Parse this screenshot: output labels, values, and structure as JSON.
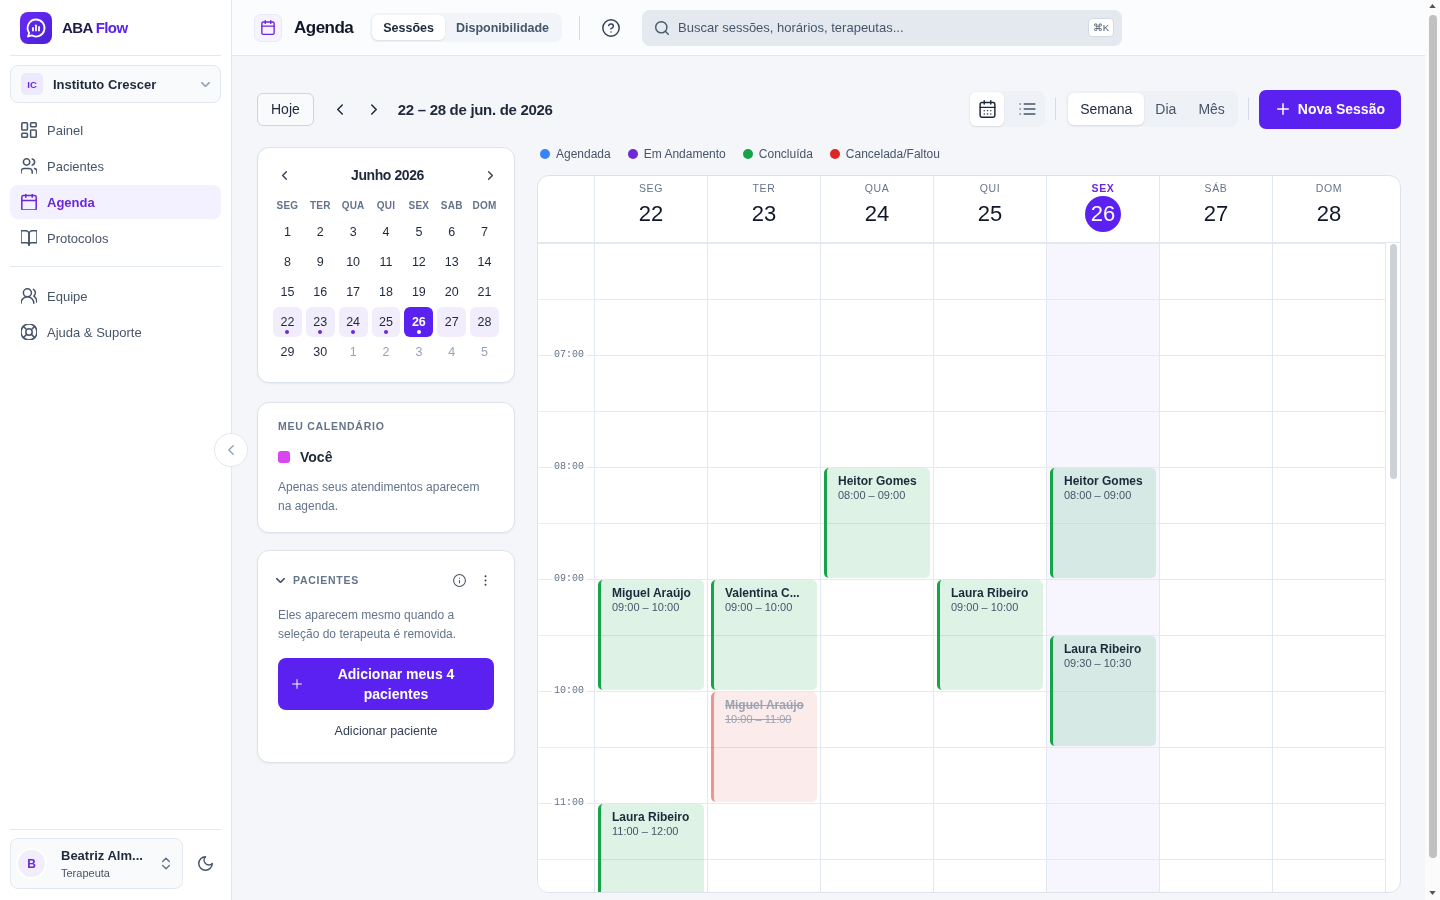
{
  "sidebar": {
    "brand": {
      "name": "ABA",
      "accent": "Flow"
    },
    "organization": {
      "initials": "IC",
      "name": "Instituto Crescer"
    },
    "nav": [
      {
        "label": "Painel",
        "selected": false
      },
      {
        "label": "Pacientes",
        "selected": false
      },
      {
        "label": "Agenda",
        "selected": true
      },
      {
        "label": "Protocolos",
        "selected": false
      }
    ],
    "nav_secondary": [
      {
        "label": "Equipe",
        "selected": false
      },
      {
        "label": "Ajuda & Suporte",
        "selected": false
      }
    ],
    "user": {
      "initial": "B",
      "name": "Beatriz Alm...",
      "role": "Terapeuta"
    }
  },
  "header": {
    "title": "Agenda",
    "tabs": [
      {
        "label": "Sessões",
        "selected": true
      },
      {
        "label": "Disponibilidade",
        "selected": false
      }
    ],
    "search": {
      "placeholder": "Buscar sessões, horários, terapeutas...",
      "shortcut": "⌘K"
    }
  },
  "toolbar": {
    "today_button": "Hoje",
    "range": "22 – 28 de jun. de 2026",
    "layouts": [
      {
        "selected": true
      },
      {
        "selected": false
      }
    ],
    "views": [
      {
        "label": "Semana",
        "selected": true
      },
      {
        "label": "Dia",
        "selected": false
      },
      {
        "label": "Mês",
        "selected": false
      }
    ],
    "new_button": "Nova Sessão"
  },
  "mini_calendar": {
    "title": "Junho 2026",
    "weekdays": [
      "SEG",
      "TER",
      "QUA",
      "QUI",
      "SEX",
      "SAB",
      "DOM"
    ],
    "weeks": [
      [
        {
          "day": "1",
          "other_month": false,
          "in_week": false,
          "selected": false,
          "has_sessions": false
        },
        {
          "day": "2",
          "other_month": false,
          "in_week": false,
          "selected": false,
          "has_sessions": false
        },
        {
          "day": "3",
          "other_month": false,
          "in_week": false,
          "selected": false,
          "has_sessions": false
        },
        {
          "day": "4",
          "other_month": false,
          "in_week": false,
          "selected": false,
          "has_sessions": false
        },
        {
          "day": "5",
          "other_month": false,
          "in_week": false,
          "selected": false,
          "has_sessions": false
        },
        {
          "day": "6",
          "other_month": false,
          "in_week": false,
          "selected": false,
          "has_sessions": false
        },
        {
          "day": "7",
          "other_month": false,
          "in_week": false,
          "selected": false,
          "has_sessions": false
        }
      ],
      [
        {
          "day": "8",
          "other_month": false,
          "in_week": false,
          "selected": false,
          "has_sessions": false
        },
        {
          "day": "9",
          "other_month": false,
          "in_week": false,
          "selected": false,
          "has_sessions": false
        },
        {
          "day": "10",
          "other_month": false,
          "in_week": false,
          "selected": false,
          "has_sessions": false
        },
        {
          "day": "11",
          "other_month": false,
          "in_week": false,
          "selected": false,
          "has_sessions": false
        },
        {
          "day": "12",
          "other_month": false,
          "in_week": false,
          "selected": false,
          "has_sessions": false
        },
        {
          "day": "13",
          "other_month": false,
          "in_week": false,
          "selected": false,
          "has_sessions": false
        },
        {
          "day": "14",
          "other_month": false,
          "in_week": false,
          "selected": false,
          "has_sessions": false
        }
      ],
      [
        {
          "day": "15",
          "other_month": false,
          "in_week": false,
          "selected": false,
          "has_sessions": false
        },
        {
          "day": "16",
          "other_month": false,
          "in_week": false,
          "selected": false,
          "has_sessions": false
        },
        {
          "day": "17",
          "other_month": false,
          "in_week": false,
          "selected": false,
          "has_sessions": false
        },
        {
          "day": "18",
          "other_month": false,
          "in_week": false,
          "selected": false,
          "has_sessions": false
        },
        {
          "day": "19",
          "other_month": false,
          "in_week": false,
          "selected": false,
          "has_sessions": false
        },
        {
          "day": "20",
          "other_month": false,
          "in_week": false,
          "selected": false,
          "has_sessions": false
        },
        {
          "day": "21",
          "other_month": false,
          "in_week": false,
          "selected": false,
          "has_sessions": false
        }
      ],
      [
        {
          "day": "22",
          "other_month": false,
          "in_week": true,
          "selected": false,
          "has_sessions": true
        },
        {
          "day": "23",
          "other_month": false,
          "in_week": true,
          "selected": false,
          "has_sessions": true
        },
        {
          "day": "24",
          "other_month": false,
          "in_week": true,
          "selected": false,
          "has_sessions": true
        },
        {
          "day": "25",
          "other_month": false,
          "in_week": true,
          "selected": false,
          "has_sessions": true
        },
        {
          "day": "26",
          "other_month": false,
          "in_week": true,
          "selected": true,
          "has_sessions": true
        },
        {
          "day": "27",
          "other_month": false,
          "in_week": true,
          "selected": false,
          "has_sessions": false
        },
        {
          "day": "28",
          "other_month": false,
          "in_week": true,
          "selected": false,
          "has_sessions": false
        }
      ],
      [
        {
          "day": "29",
          "other_month": false,
          "in_week": false,
          "selected": false,
          "has_sessions": false
        },
        {
          "day": "30",
          "other_month": false,
          "in_week": false,
          "selected": false,
          "has_sessions": false
        },
        {
          "day": "1",
          "other_month": true,
          "in_week": false,
          "selected": false,
          "has_sessions": false
        },
        {
          "day": "2",
          "other_month": true,
          "in_week": false,
          "selected": false,
          "has_sessions": false
        },
        {
          "day": "3",
          "other_month": true,
          "in_week": false,
          "selected": false,
          "has_sessions": false
        },
        {
          "day": "4",
          "other_month": true,
          "in_week": false,
          "selected": false,
          "has_sessions": false
        },
        {
          "day": "5",
          "other_month": true,
          "in_week": false,
          "selected": false,
          "has_sessions": false
        }
      ]
    ]
  },
  "my_calendar": {
    "heading": "MEU CALENDÁRIO",
    "calendars": [
      {
        "label": "Você",
        "color": "#d946ef"
      }
    ],
    "note": "Apenas seus atendimentos aparecem na agenda."
  },
  "patients_panel": {
    "heading": "PACIENTES",
    "expanded": true,
    "note": "Eles aparecem mesmo quando a seleção do terapeuta é removida.",
    "add_all_button": "Adicionar meus 4 pacientes",
    "add_link": "Adicionar paciente"
  },
  "legend": [
    {
      "kind": "scheduled",
      "label": "Agendada",
      "color": "#3b82f6"
    },
    {
      "kind": "in_progress",
      "label": "Em Andamento",
      "color": "#6d28d9"
    },
    {
      "kind": "completed",
      "label": "Concluída",
      "color": "#16a34a"
    },
    {
      "kind": "cancelled",
      "label": "Cancelada/Faltou",
      "color": "#dc2626"
    }
  ],
  "week": {
    "time_labels": [
      "07:00",
      "08:00",
      "09:00",
      "10:00",
      "11:00"
    ],
    "days": [
      {
        "weekday": "SEG",
        "date": "22",
        "today": false,
        "events": [
          {
            "kind": "completed",
            "patient": "Miguel Araújo",
            "time": "09:00 – 10:00"
          },
          {
            "kind": "completed",
            "patient": "Laura Ribeiro",
            "time": "11:00 – 12:00"
          }
        ]
      },
      {
        "weekday": "TER",
        "date": "23",
        "today": false,
        "events": [
          {
            "kind": "completed",
            "patient": "Valentina C...",
            "time": "09:00 – 10:00"
          },
          {
            "kind": "cancelled",
            "patient": "Miguel Araújo",
            "time": "10:00 – 11:00"
          }
        ]
      },
      {
        "weekday": "QUA",
        "date": "24",
        "today": false,
        "events": [
          {
            "kind": "completed",
            "patient": "Heitor Gomes",
            "time": "08:00 – 09:00"
          }
        ]
      },
      {
        "weekday": "QUI",
        "date": "25",
        "today": false,
        "events": [
          {
            "kind": "completed",
            "patient": "Laura Ribeiro",
            "time": "09:00 – 10:00"
          }
        ]
      },
      {
        "weekday": "SEX",
        "date": "26",
        "today": true,
        "events": [
          {
            "kind": "completed",
            "patient": "Heitor Gomes",
            "time": "08:00 – 09:00"
          },
          {
            "kind": "completed",
            "patient": "Laura Ribeiro",
            "time": "09:30 – 10:30"
          }
        ]
      },
      {
        "weekday": "SÁB",
        "date": "27",
        "today": false
      },
      {
        "weekday": "DOM",
        "date": "28",
        "today": false
      }
    ]
  }
}
